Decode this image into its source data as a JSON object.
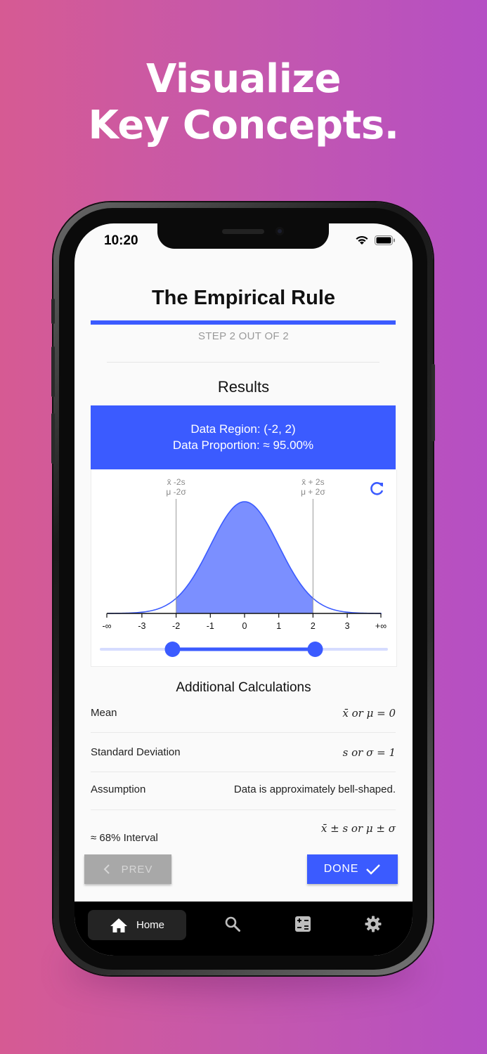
{
  "headline": {
    "line1": "Visualize",
    "line2": "Key Concepts."
  },
  "status_bar": {
    "time": "10:20"
  },
  "screen": {
    "title": "The Empirical Rule",
    "step_text": "STEP 2 OUT OF 2",
    "results_title": "Results",
    "results": {
      "data_region": "Data Region: (-2, 2)",
      "data_proportion": "Data Proportion: ≈ 95.00%"
    }
  },
  "chart_data": {
    "type": "area",
    "x_ticks": [
      "-∞",
      "-3",
      "-2",
      "-1",
      "0",
      "1",
      "2",
      "3",
      "+∞"
    ],
    "shaded_region": [
      -2,
      2
    ],
    "left_marker": {
      "line1": "x̄ -2s",
      "line2": "μ -2σ"
    },
    "right_marker": {
      "line1": "x̄ + 2s",
      "line2": "μ + 2σ"
    },
    "slider": {
      "low": -2,
      "high": 2,
      "min": -4,
      "max": 4
    },
    "colors": {
      "fill": "#7b8fff",
      "stroke": "#3b5bff"
    }
  },
  "calculations": {
    "title": "Additional Calculations",
    "rows": [
      {
        "label": "Mean",
        "value": "x̄ or μ = 0"
      },
      {
        "label": "Standard Deviation",
        "value": "s or σ = 1"
      },
      {
        "label": "Assumption",
        "value": "Data is approximately bell-shaped."
      },
      {
        "label": "≈ 68% Interval",
        "value": "x̄ ± s or μ ± σ"
      }
    ]
  },
  "buttons": {
    "prev": "PREV",
    "done": "DONE"
  },
  "tabbar": {
    "home": "Home"
  },
  "colors": {
    "accent": "#3b5bff",
    "background_gradient": [
      "#d65a93",
      "#b54fc4"
    ]
  }
}
